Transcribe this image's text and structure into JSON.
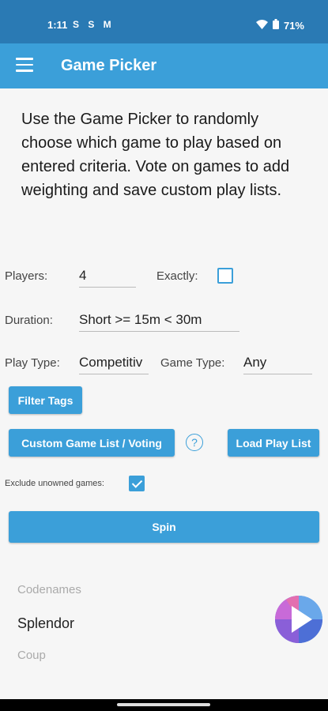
{
  "status_bar": {
    "time": "1:11",
    "notification_icons": "S S M",
    "battery": "71%"
  },
  "app_bar": {
    "title": "Game Picker"
  },
  "intro_text": "Use the Game Picker to randomly choose which game to play based on entered criteria. Vote on games to add weighting and save custom play lists.",
  "form": {
    "players_label": "Players:",
    "players_value": "4",
    "exactly_label": "Exactly:",
    "exactly_checked": false,
    "duration_label": "Duration:",
    "duration_value": "Short >= 15m < 30m",
    "play_type_label": "Play Type:",
    "play_type_value": "Competitiv",
    "game_type_label": "Game Type:",
    "game_type_value": "Any",
    "exclude_label": "Exclude unowned games:",
    "exclude_checked": true
  },
  "buttons": {
    "filter_tags": "Filter Tags",
    "custom_list": "Custom Game List / Voting",
    "load_play_list": "Load Play List",
    "spin": "Spin"
  },
  "help_symbol": "?",
  "results": [
    "Codenames",
    "Splendor",
    "Coup"
  ],
  "colors": {
    "accent": "#3b9fd9",
    "status_bar": "#2a7ab4"
  }
}
